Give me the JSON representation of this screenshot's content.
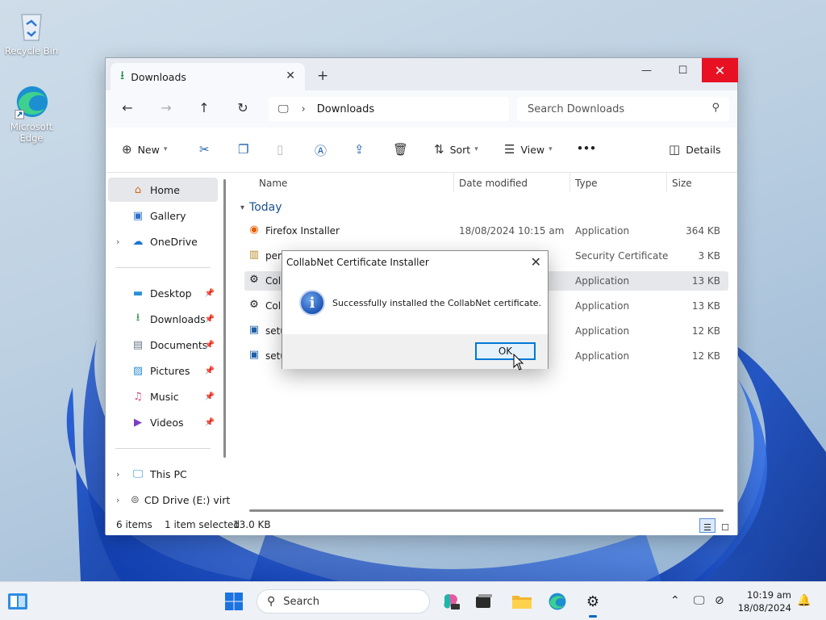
{
  "desktop": {
    "icons": [
      {
        "label": "Recycle Bin",
        "icon": "recycle-bin-icon"
      },
      {
        "label": "Microsoft Edge",
        "icon": "edge-icon"
      }
    ]
  },
  "window": {
    "tab_title": "Downloads",
    "new_tab": "+",
    "address_crumb": "Downloads",
    "search_placeholder": "Search Downloads",
    "toolbar": {
      "new_label": "New",
      "sort_label": "Sort",
      "view_label": "View",
      "more_label": "•••",
      "details_label": "Details"
    },
    "sidebar": {
      "home": "Home",
      "gallery": "Gallery",
      "onedrive": "OneDrive",
      "desktop": "Desktop",
      "downloads": "Downloads",
      "documents": "Documents",
      "pictures": "Pictures",
      "music": "Music",
      "videos": "Videos",
      "this_pc": "This PC",
      "cd_drive": "CD Drive (E:) virt"
    },
    "columns": {
      "name": "Name",
      "date": "Date modified",
      "type": "Type",
      "size": "Size"
    },
    "group_label": "Today",
    "files": [
      {
        "name": "Firefox Installer",
        "date": "18/08/2024 10:15 am",
        "type": "Application",
        "size": "364 KB",
        "selected": false
      },
      {
        "name": "pem",
        "date": "",
        "type": "Security Certificate",
        "size": "3 KB",
        "selected": false
      },
      {
        "name": "Coll",
        "date": "",
        "type": "Application",
        "size": "13 KB",
        "selected": true
      },
      {
        "name": "Coll",
        "date": "",
        "type": "Application",
        "size": "13 KB",
        "selected": false
      },
      {
        "name": "setu",
        "date": "",
        "type": "Application",
        "size": "12 KB",
        "selected": false
      },
      {
        "name": "setu",
        "date": "",
        "type": "Application",
        "size": "12 KB",
        "selected": false
      }
    ],
    "status": {
      "items": "6 items",
      "selected": "1 item selected",
      "size": "13.0 KB"
    }
  },
  "dialog": {
    "title": "CollabNet Certificate Installer",
    "message": "Successfully installed the CollabNet certificate.",
    "ok_label": "OK"
  },
  "taskbar": {
    "search_label": "Search",
    "time": "10:19 am",
    "date": "18/08/2024"
  },
  "colors": {
    "accent": "#0078d7",
    "close_red": "#e81123",
    "selection": "#e5e7ea"
  }
}
